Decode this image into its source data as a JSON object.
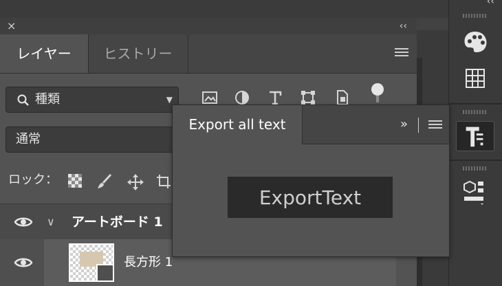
{
  "layers_panel": {
    "close_glyph": "×",
    "collapse_glyph": "‹‹",
    "tabs": [
      {
        "label": "レイヤー",
        "active": true
      },
      {
        "label": "ヒストリー",
        "active": false
      }
    ],
    "filter": {
      "label": "種類"
    },
    "blend_mode": {
      "value": "通常"
    },
    "lock_label": "ロック：",
    "layers": [
      {
        "name": "アートボード 1",
        "type": "artboard"
      },
      {
        "name": "長方形 1",
        "type": "shape"
      }
    ]
  },
  "dock": {
    "collapse_glyph": "‹‹",
    "icons": [
      "palette-icon",
      "swatches-grid-icon",
      "export-text-plugin-icon",
      "libraries-icon"
    ]
  },
  "export_panel": {
    "tab_label": "Export all text",
    "expand_glyph": "»",
    "button_label": "ExportText"
  },
  "colors": {
    "panel_bg": "#535353",
    "dark_bg": "#3a3a3a",
    "button_bg": "#2a2a2a",
    "text": "#e6e6e6"
  }
}
